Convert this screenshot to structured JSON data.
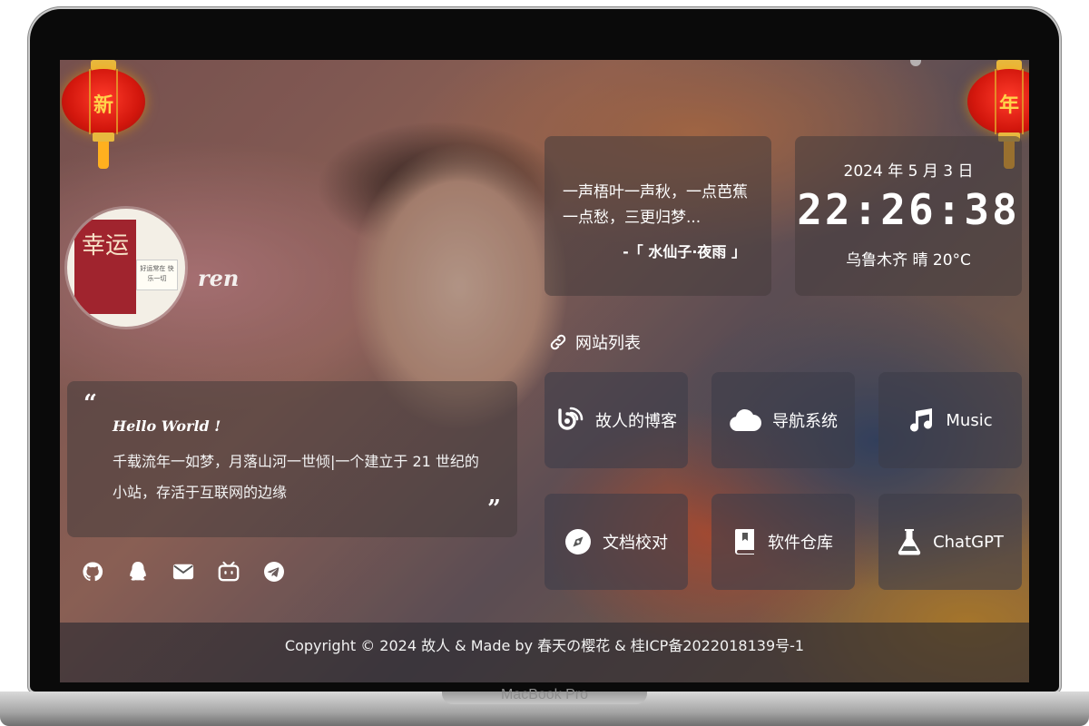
{
  "device": {
    "label": "MacBook Pro"
  },
  "lanterns": {
    "left_char": "新",
    "right_char": "年"
  },
  "profile": {
    "username": "ren",
    "avatar_card_text": "幸运",
    "avatar_note_text": "好运常在 快乐一切"
  },
  "hello": {
    "open_quote": "“",
    "close_quote": "”",
    "title": "Hello World !",
    "text": "千载流年一如梦，月落山河一世倾|一个建立于 21 世纪的小站，存活于互联网的边缘"
  },
  "socials": [
    {
      "icon": "github-icon"
    },
    {
      "icon": "qq-icon"
    },
    {
      "icon": "mail-icon"
    },
    {
      "icon": "bilibili-icon"
    },
    {
      "icon": "telegram-icon"
    }
  ],
  "poem": {
    "text": "一声梧叶一声秋，一点芭蕉一点愁，三更归梦...",
    "source": "-「 水仙子·夜雨 」"
  },
  "clock": {
    "date": "2024 年 5 月 3 日",
    "time": "22:26:38",
    "weather": "乌鲁木齐 晴 20°C"
  },
  "sites": {
    "title": "网站列表",
    "items": [
      {
        "label": "故人的博客",
        "icon": "blog-icon"
      },
      {
        "label": "导航系统",
        "icon": "cloud-icon"
      },
      {
        "label": "Music",
        "icon": "music-icon"
      },
      {
        "label": "文档校对",
        "icon": "compass-icon"
      },
      {
        "label": "软件仓库",
        "icon": "book-icon"
      },
      {
        "label": "ChatGPT",
        "icon": "flask-icon"
      }
    ]
  },
  "footer": {
    "text": "Copyright © 2024 故人 & Made by 春天の樱花 & 桂ICP备2022018139号-1"
  }
}
